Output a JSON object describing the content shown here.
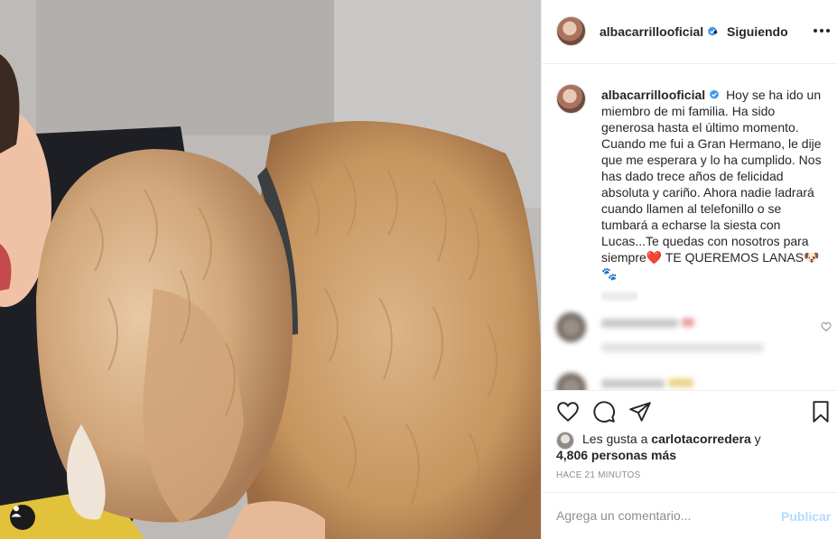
{
  "header": {
    "username": "albacarrillooficial",
    "separator": "•",
    "follow_state": "Siguiendo"
  },
  "caption": {
    "username": "albacarrillooficial",
    "text_1": "Hoy se ha ido un miembro de mi familia. Ha sido generosa hasta el último momento. Cuando me fui a Gran Hermano, le dije que me esperara y lo ha cumplido. Nos has dado trece años de felicidad absoluta y cariño. Ahora nadie ladrará cuando llamen al telefonillo o se tumbará a echarse la siesta con Lucas...Te quedas con nosotros para siempre",
    "heart_emoji": "❤️",
    "text_2": " TE QUEREMOS LANAS",
    "dog_emoji": "🐶",
    "paws_emoji": "🐾"
  },
  "likes": {
    "prefix": "Les gusta a ",
    "user": "carlotacorredera",
    "suffix": " y",
    "others": "4,806 personas más"
  },
  "timestamp": "HACE 21 MINUTOS",
  "comment_box": {
    "placeholder": "Agrega un comentario...",
    "publish_label": "Publicar"
  },
  "colors": {
    "accent_blue": "#3897f0",
    "publish_disabled": "#b3dbff",
    "verified_blue": "#3897f0",
    "heart_red": "#ed4956"
  },
  "icons": [
    "verified-badge-icon",
    "more-options-icon",
    "like-icon",
    "comment-icon",
    "share-icon",
    "save-icon",
    "heart-icon",
    "person-tag-icon"
  ]
}
